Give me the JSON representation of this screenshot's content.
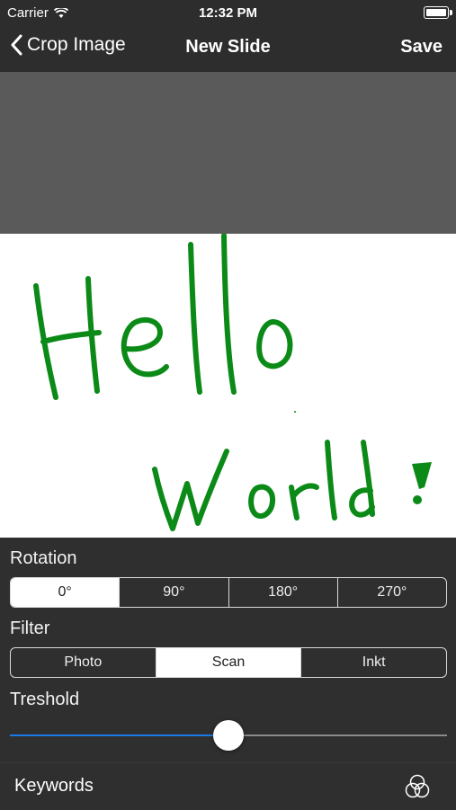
{
  "status_bar": {
    "carrier": "Carrier",
    "time": "12:32 PM"
  },
  "nav": {
    "back_label": "Crop Image",
    "title": "New Slide",
    "save_label": "Save"
  },
  "canvas": {
    "text_line1": "Hello",
    "text_line2": "World",
    "ink_color": "#0b8a17"
  },
  "rotation": {
    "label": "Rotation",
    "options": [
      "0°",
      "90°",
      "180°",
      "270°"
    ],
    "selected": "0°"
  },
  "filter": {
    "label": "Filter",
    "options": [
      "Photo",
      "Scan",
      "Inkt"
    ],
    "selected": "Scan"
  },
  "threshold": {
    "label": "Treshold",
    "value": 0.5,
    "accent": "#1a7ae8"
  },
  "bottom": {
    "keywords_label": "Keywords",
    "icon": "overlapping-circles-icon"
  }
}
